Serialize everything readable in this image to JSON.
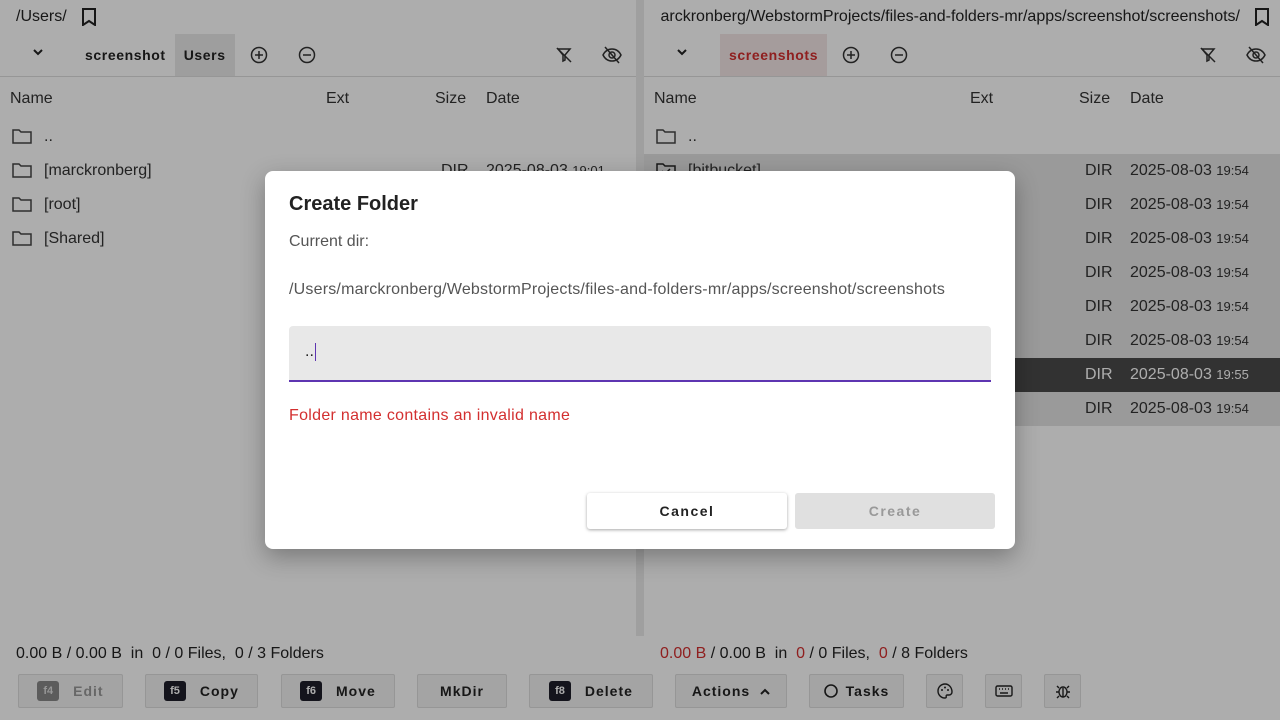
{
  "left_panel": {
    "path": "/Users/",
    "tabs": [
      {
        "label": "screenshot"
      },
      {
        "label": "Users"
      }
    ],
    "columns": {
      "name": "Name",
      "ext": "Ext",
      "size": "Size",
      "date": "Date"
    },
    "rows": [
      {
        "name": "..",
        "size": "",
        "date": "",
        "time": ""
      },
      {
        "name": "[marckronberg]",
        "size": "DIR",
        "date": "2025-08-03",
        "time": "19:01"
      },
      {
        "name": "[root]",
        "size": "",
        "date": "",
        "time": ""
      },
      {
        "name": "[Shared]",
        "size": "",
        "date": "",
        "time": ""
      }
    ],
    "status": {
      "selected_size": "0.00 B",
      "total_size": "0.00 B",
      "files_sel": "0",
      "files_total": "0",
      "folders_sel": "0",
      "folders_total": "3"
    }
  },
  "right_panel": {
    "path": "arckronberg/WebstormProjects/files-and-folders-mr/apps/screenshot/screenshots/",
    "tabs": [
      {
        "label": "screenshots"
      }
    ],
    "columns": {
      "name": "Name",
      "ext": "Ext",
      "size": "Size",
      "date": "Date"
    },
    "rows": [
      {
        "name": "..",
        "size": "",
        "date": "",
        "time": ""
      },
      {
        "name": "[bitbucket]",
        "size": "DIR",
        "date": "2025-08-03",
        "time": "19:54"
      },
      {
        "name": "",
        "size": "DIR",
        "date": "2025-08-03",
        "time": "19:54"
      },
      {
        "name": "",
        "size": "DIR",
        "date": "2025-08-03",
        "time": "19:54"
      },
      {
        "name": "",
        "size": "DIR",
        "date": "2025-08-03",
        "time": "19:54"
      },
      {
        "name": "",
        "size": "DIR",
        "date": "2025-08-03",
        "time": "19:54"
      },
      {
        "name": "",
        "size": "DIR",
        "date": "2025-08-03",
        "time": "19:54"
      },
      {
        "name": "",
        "size": "DIR",
        "date": "2025-08-03",
        "time": "19:55"
      },
      {
        "name": "",
        "size": "DIR",
        "date": "2025-08-03",
        "time": "19:54"
      }
    ],
    "status": {
      "selected_size": "0.00 B",
      "total_size": "0.00 B",
      "files_sel": "0",
      "files_total": "0",
      "folders_sel": "0",
      "folders_total": "8"
    }
  },
  "status_words": {
    "in": "in",
    "files": "Files,",
    "folders": "Folders",
    "sep": "/"
  },
  "toolbar": {
    "edit": {
      "key": "f4",
      "label": "Edit"
    },
    "copy": {
      "key": "f5",
      "label": "Copy"
    },
    "move": {
      "key": "f6",
      "label": "Move"
    },
    "mkdir": {
      "label": "MkDir"
    },
    "delete": {
      "key": "f8",
      "label": "Delete"
    },
    "actions": {
      "label": "Actions"
    },
    "tasks": {
      "label": "Tasks"
    }
  },
  "dialog": {
    "title": "Create Folder",
    "current_dir_label": "Current dir:",
    "current_dir": "/Users/marckronberg/WebstormProjects/files-and-folders-mr/apps/screenshot/screenshots",
    "input_value": "..",
    "error": "Folder name contains an invalid name",
    "cancel_label": "Cancel",
    "create_label": "Create"
  },
  "colors": {
    "accent": "#5e35b1",
    "error": "#d32f2f",
    "key_bg": "#1e1e2a"
  }
}
